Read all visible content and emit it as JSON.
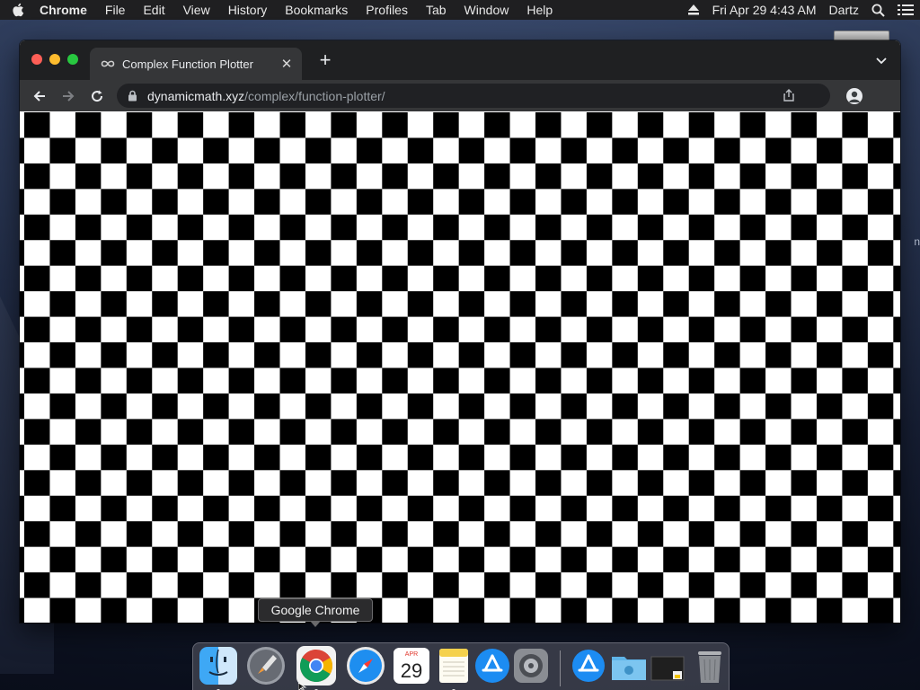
{
  "menubar": {
    "app_name": "Chrome",
    "items": [
      "File",
      "Edit",
      "View",
      "History",
      "Bookmarks",
      "Profiles",
      "Tab",
      "Window",
      "Help"
    ],
    "clock": "Fri Apr 29  4:43 AM",
    "user": "Dartz"
  },
  "browser": {
    "tab_title": "Complex Function Plotter",
    "url_host": "dynamicmath.xyz",
    "url_path": "/complex/function-plotter/"
  },
  "viewport": {
    "pattern": "checkerboard",
    "colors": {
      "dark": "#000000",
      "light": "#ffffff"
    }
  },
  "tooltip": {
    "text": "Google Chrome"
  },
  "dock": {
    "items": [
      {
        "name": "finder-icon",
        "running": true
      },
      {
        "name": "launchpad-icon",
        "running": false
      },
      {
        "name": "chrome-icon",
        "running": true
      },
      {
        "name": "safari-icon",
        "running": false
      },
      {
        "name": "calendar-icon",
        "running": false,
        "month": "APR",
        "day": "29"
      },
      {
        "name": "notes-icon",
        "running": true
      },
      {
        "name": "app-store-icon",
        "running": false
      },
      {
        "name": "system-preferences-icon",
        "running": false
      },
      {
        "name": "app-store-downloads-icon",
        "running": false
      },
      {
        "name": "downloads-folder-icon",
        "running": false
      },
      {
        "name": "screenshot-thumbnail-icon",
        "running": false
      },
      {
        "name": "trash-icon",
        "running": false
      }
    ]
  }
}
